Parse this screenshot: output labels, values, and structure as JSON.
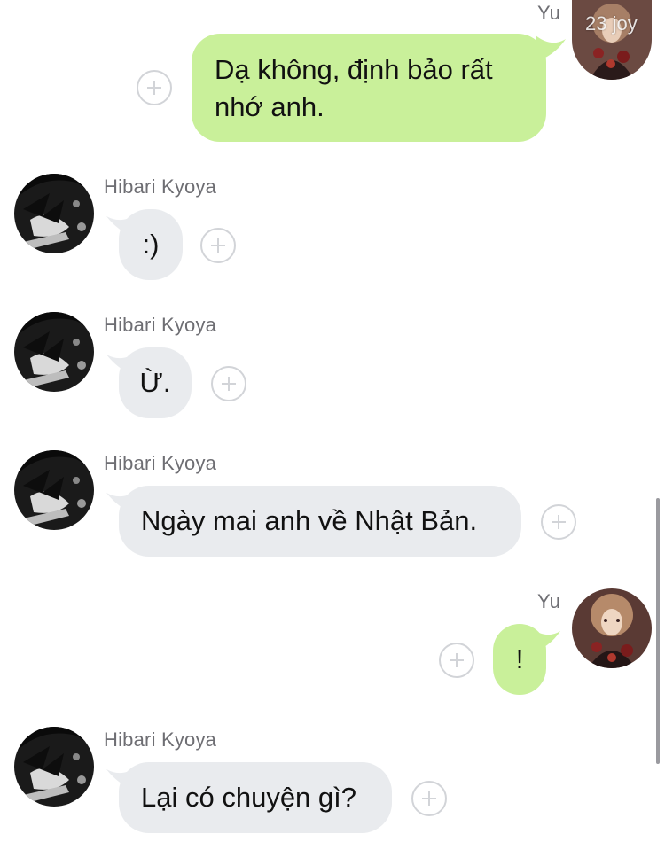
{
  "participants": {
    "self": "Yu",
    "other": "Hibari Kyoya"
  },
  "messages": [
    {
      "sender": "Yu",
      "text": "Dạ không, định bảo rất\nnhớ anh."
    },
    {
      "sender": "Hibari Kyoya",
      "text": ":)"
    },
    {
      "sender": "Hibari Kyoya",
      "text": "Ừ."
    },
    {
      "sender": "Hibari Kyoya",
      "text": "Ngày mai anh về Nhật Bản."
    },
    {
      "sender": "Yu",
      "text": "!"
    },
    {
      "sender": "Hibari Kyoya",
      "text": "Lại có chuyện gì?"
    }
  ],
  "avatar_overlay_text": "23 joy",
  "colors": {
    "incoming_bubble": "#e9ebee",
    "outgoing_bubble": "#c9f09a",
    "name_text": "#6e6e73",
    "add_icon": "#d2d4d8"
  },
  "icons": {
    "add_reaction": "plus-circle-icon",
    "other_avatar": "avatar-hibari",
    "self_avatar": "avatar-yu"
  }
}
